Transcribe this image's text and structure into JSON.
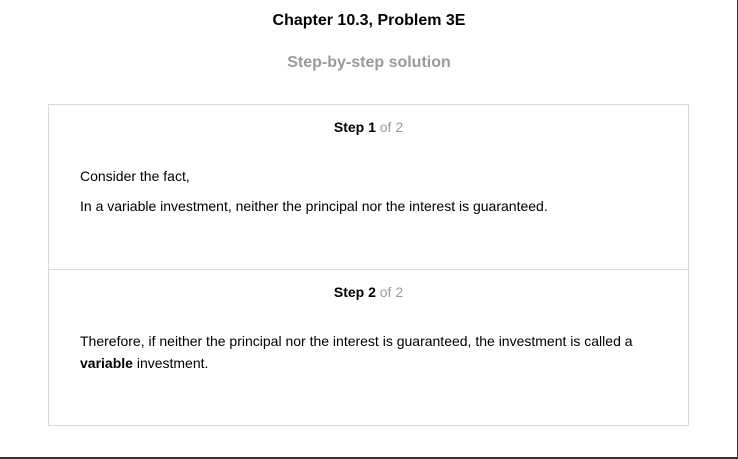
{
  "header": {
    "title": "Chapter 10.3, Problem 3E",
    "subtitle": "Step-by-step solution"
  },
  "steps": [
    {
      "label": "Step 1",
      "of": " of 2",
      "paragraphs": [
        "Consider the fact,",
        "In a variable investment, neither the principal nor the interest is guaranteed."
      ]
    },
    {
      "label": "Step 2",
      "of": " of 2",
      "text_before": "Therefore, if neither the principal nor the interest is guaranteed, the investment is called a ",
      "bold_word": "variable",
      "text_after": " investment."
    }
  ],
  "colors": {
    "muted_text": "#9a9a9a",
    "border": "#d9d9d9",
    "frame": "#333333"
  }
}
